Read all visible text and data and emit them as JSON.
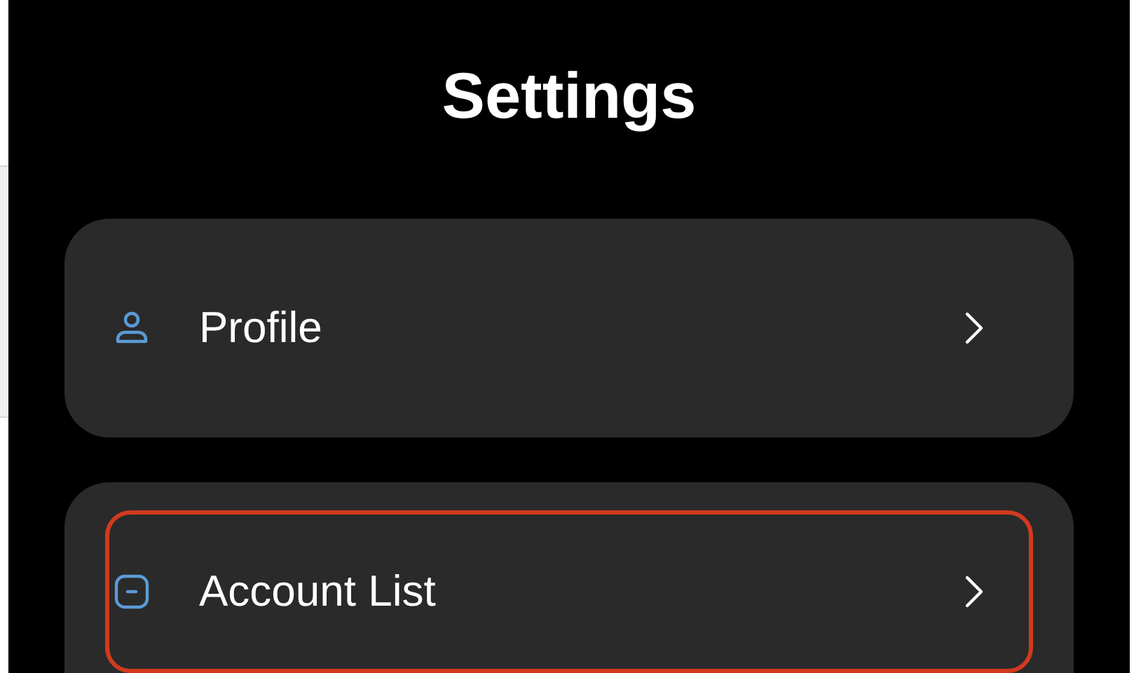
{
  "title": "Settings",
  "sections": [
    {
      "items": [
        {
          "label": "Profile",
          "kind": "profile",
          "highlighted": false
        }
      ]
    },
    {
      "items": [
        {
          "label": "Account List",
          "kind": "accounts",
          "highlighted": true
        }
      ]
    }
  ]
}
